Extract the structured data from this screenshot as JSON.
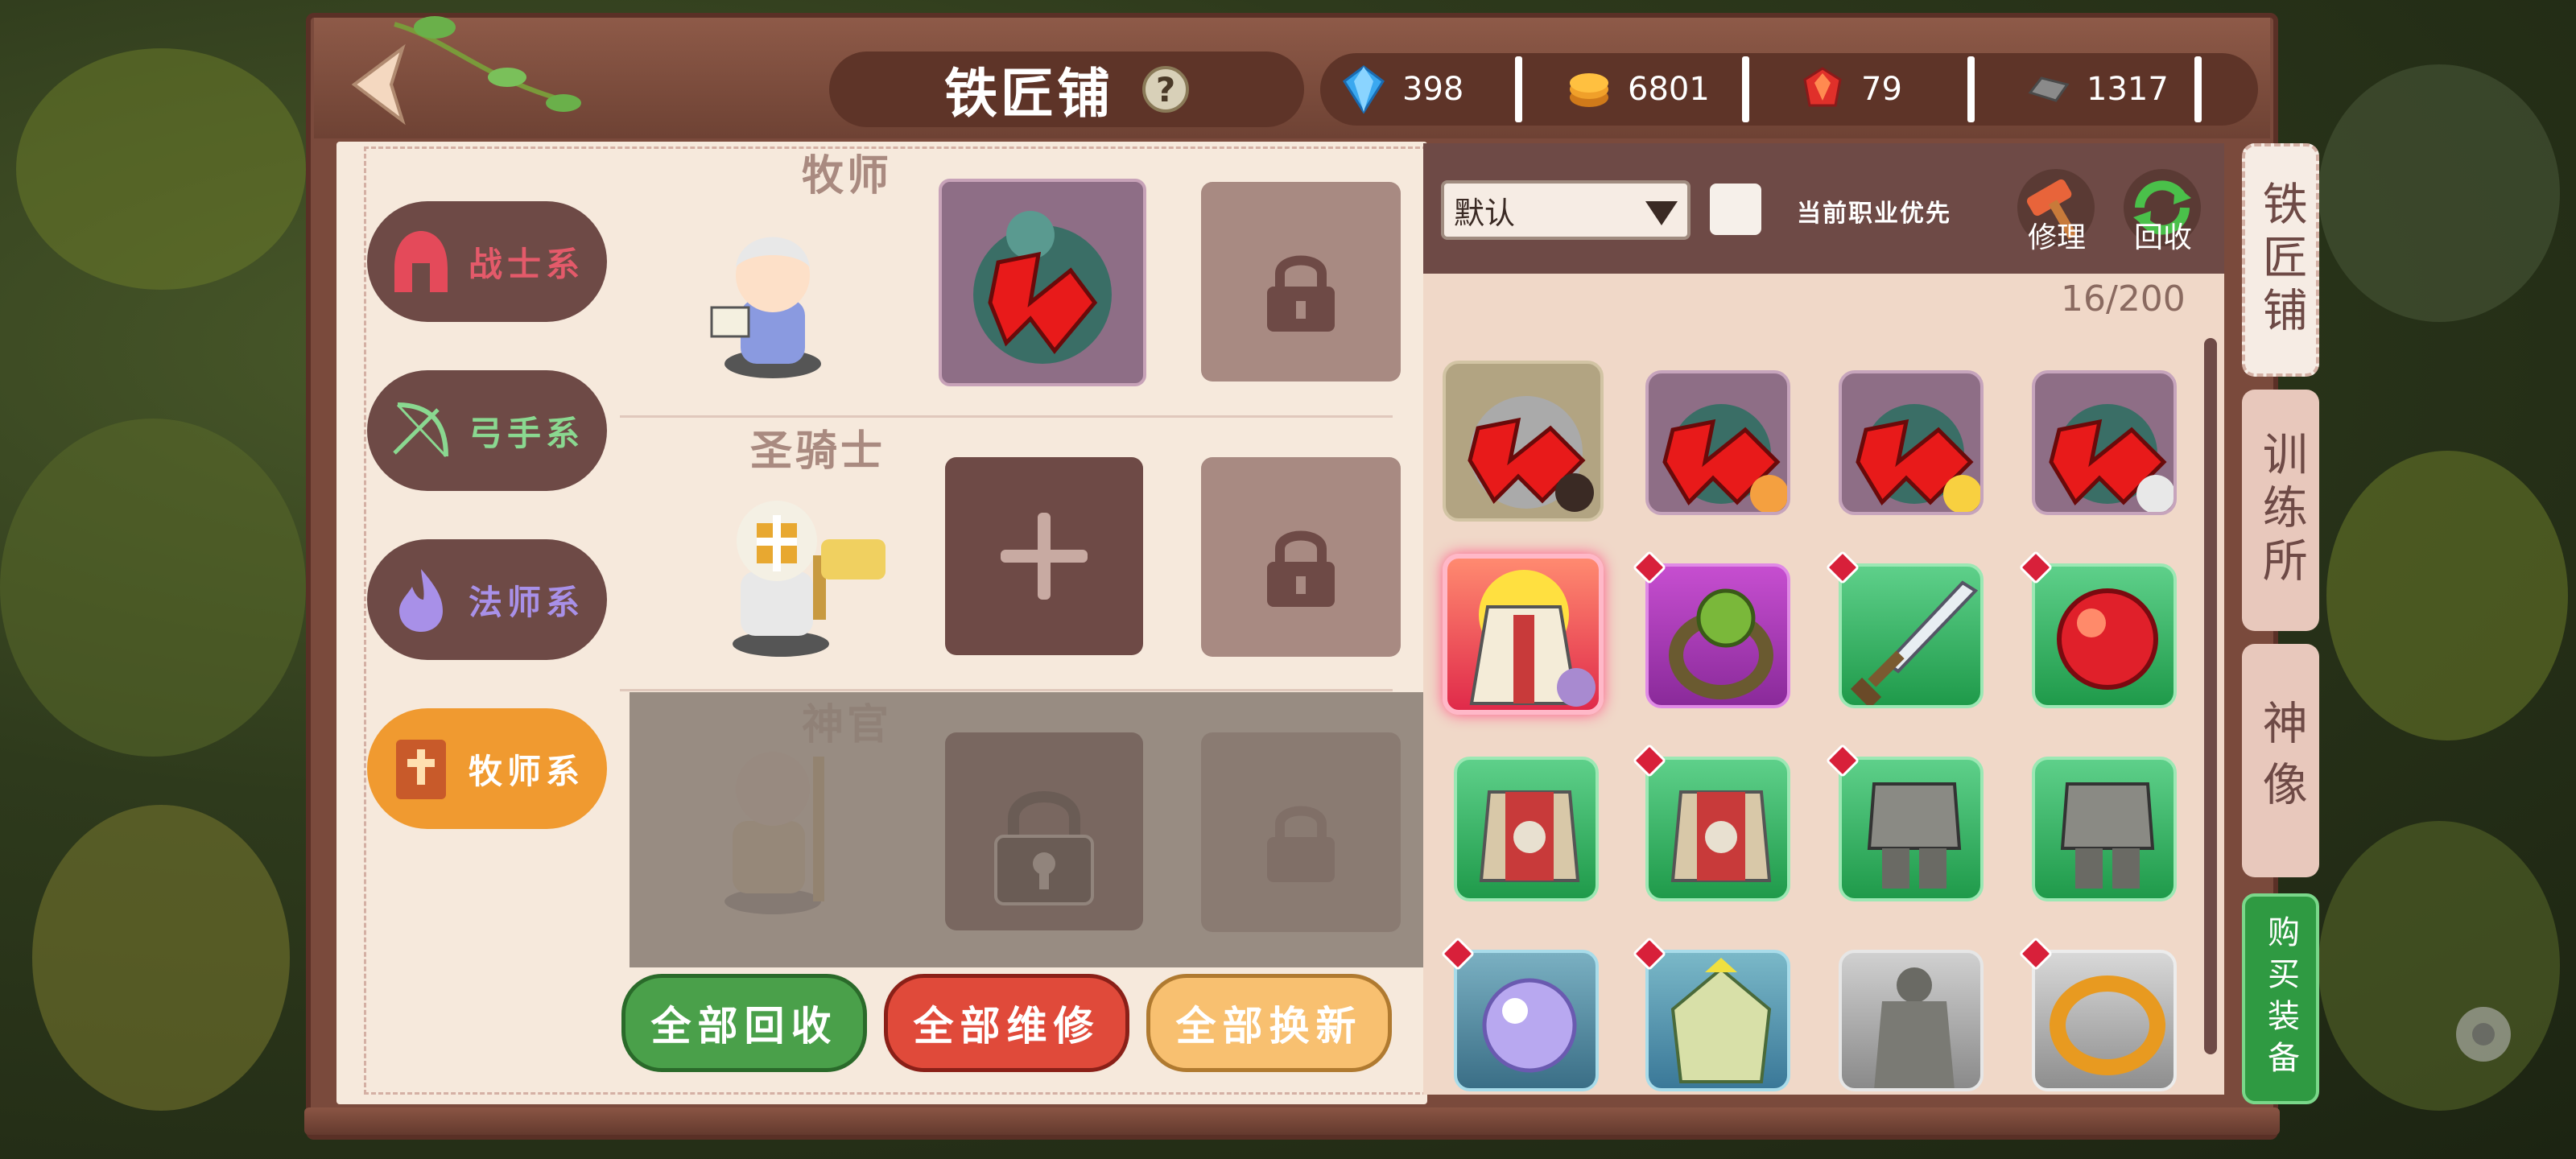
{
  "header": {
    "title": "铁匠铺",
    "help_icon": "question-icon",
    "back_icon": "back-arrow-icon"
  },
  "resources": [
    {
      "icon": "diamond-icon",
      "value": "398"
    },
    {
      "icon": "gold-coin-icon",
      "value": "6801"
    },
    {
      "icon": "red-gem-icon",
      "value": "79"
    },
    {
      "icon": "iron-ingot-icon",
      "value": "1317"
    }
  ],
  "categories": [
    {
      "label": "战士系",
      "icon": "helmet-icon",
      "active": false,
      "color": "#e45a6a"
    },
    {
      "label": "弓手系",
      "icon": "bow-icon",
      "active": false,
      "color": "#8ad890"
    },
    {
      "label": "法师系",
      "icon": "flame-icon",
      "active": false,
      "color": "#a890e8"
    },
    {
      "label": "牧师系",
      "icon": "bible-icon",
      "active": true,
      "color": "#ffffff"
    }
  ],
  "classes": [
    {
      "name": "牧师",
      "state": "unlocked",
      "slots": [
        "equipped",
        "locked"
      ]
    },
    {
      "name": "圣骑士",
      "state": "unlocked",
      "slots": [
        "add",
        "locked"
      ]
    },
    {
      "name": "神官",
      "state": "locked",
      "slots": [
        "locked",
        "locked"
      ]
    }
  ],
  "actions": {
    "recycle_all": "全部回收",
    "repair_all": "全部维修",
    "renew_all": "全部换新"
  },
  "inventory": {
    "sort_value": "默认",
    "priority_label": "当前职业优先",
    "repair_label": "修理",
    "recycle_label": "回收",
    "count": "16/200"
  },
  "tabs": {
    "blacksmith": "铁匠铺",
    "training": "训练所",
    "statue": "神像",
    "buy": "购买装备"
  },
  "colors": {
    "panel": "#7a4a3c",
    "pane": "#f6e9dc",
    "recycle_btn": "#4aa04a",
    "repair_btn": "#e04a3a",
    "renew_btn": "#f4b050"
  }
}
